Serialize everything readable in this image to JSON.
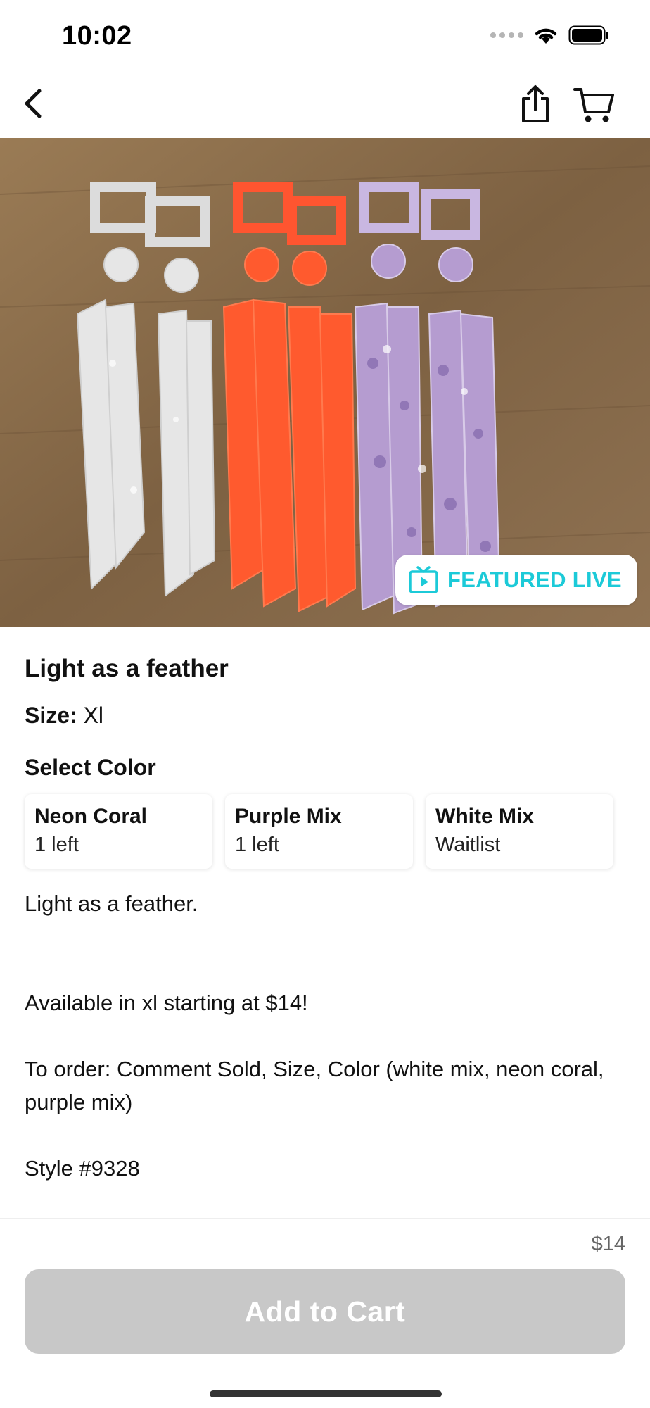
{
  "status_bar": {
    "time": "10:02"
  },
  "nav": {
    "back_icon": "chevron-left-icon",
    "share_icon": "share-icon",
    "cart_icon": "cart-icon"
  },
  "image": {
    "badge_icon": "tv-play-icon",
    "badge_label": "FEATURED LIVE",
    "badge_color": "#1ccad8"
  },
  "product": {
    "title": "Light as a feather",
    "size_label": "Size:",
    "size_value": "Xl",
    "select_color_heading": "Select Color",
    "colors": [
      {
        "name": "Neon Coral",
        "stock": "1 left"
      },
      {
        "name": "Purple Mix",
        "stock": "1 left"
      },
      {
        "name": "White Mix",
        "stock": "Waitlist"
      }
    ],
    "description": [
      "Light as a feather.",
      "Available in xl starting at $14!",
      "To order: Comment Sold, Size, Color (white mix, neon coral, purple mix)",
      "Style #9328"
    ]
  },
  "footer": {
    "price": "$14",
    "add_to_cart_label": "Add to Cart",
    "button_color": "#c8c8c8"
  }
}
